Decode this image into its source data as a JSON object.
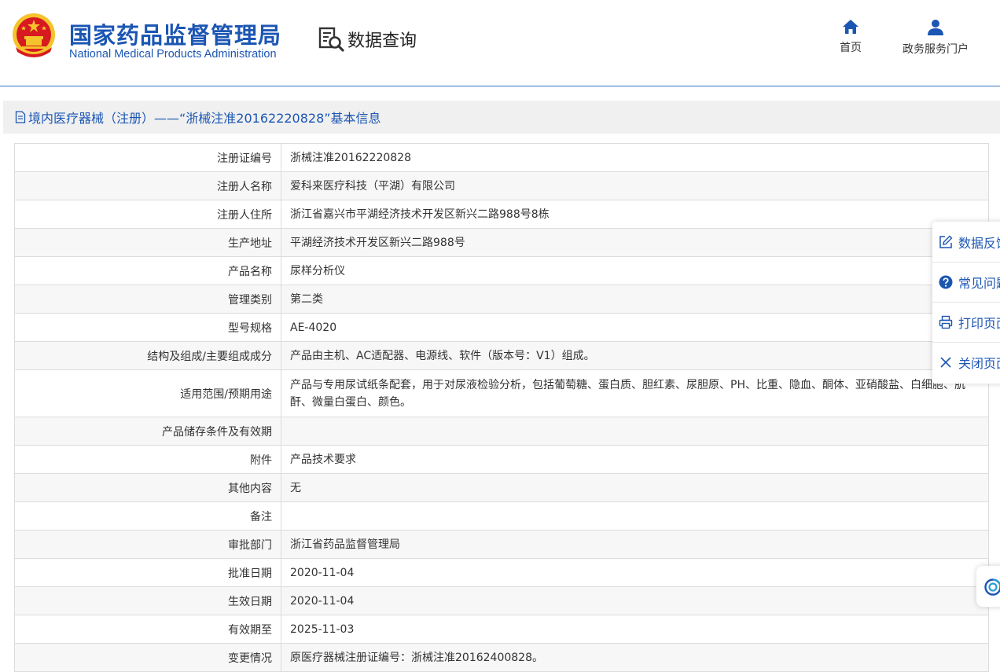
{
  "header": {
    "logo_cn": "国家药品监督管理局",
    "logo_en": "National Medical Products Administration",
    "query_label": "数据查询",
    "nav": [
      {
        "label": "首页",
        "icon": "home-icon"
      },
      {
        "label": "政务服务门户",
        "icon": "user-icon"
      }
    ]
  },
  "section": {
    "title": "境内医疗器械（注册）——“浙械注准20162220828”基本信息"
  },
  "table": {
    "rows": [
      {
        "key": "注册证编号",
        "value": "浙械注准20162220828"
      },
      {
        "key": "注册人名称",
        "value": "爱科来医疗科技（平湖）有限公司"
      },
      {
        "key": "注册人住所",
        "value": "浙江省嘉兴市平湖经济技术开发区新兴二路988号8栋"
      },
      {
        "key": "生产地址",
        "value": "平湖经济技术开发区新兴二路988号"
      },
      {
        "key": "产品名称",
        "value": "尿样分析仪"
      },
      {
        "key": "管理类别",
        "value": "第二类"
      },
      {
        "key": "型号规格",
        "value": "AE-4020"
      },
      {
        "key": "结构及组成/主要组成成分",
        "value": "产品由主机、AC适配器、电源线、软件（版本号：V1）组成。"
      },
      {
        "key": "适用范围/预期用途",
        "value": "产品与专用尿试纸条配套，用于对尿液检验分析，包括葡萄糖、蛋白质、胆红素、尿胆原、PH、比重、隐血、酮体、亚硝酸盐、白细胞、肌酐、微量白蛋白、颜色。"
      },
      {
        "key": "产品储存条件及有效期",
        "value": ""
      },
      {
        "key": "附件",
        "value": "产品技术要求"
      },
      {
        "key": "其他内容",
        "value": "无"
      },
      {
        "key": "备注",
        "value": ""
      },
      {
        "key": "审批部门",
        "value": "浙江省药品监督管理局"
      },
      {
        "key": "批准日期",
        "value": "2020-11-04"
      },
      {
        "key": "生效日期",
        "value": "2020-11-04"
      },
      {
        "key": "有效期至",
        "value": "2025-11-03"
      },
      {
        "key": "变更情况",
        "value": "原医疗器械注册证编号：浙械注准20162400828。"
      }
    ]
  },
  "side_panel": {
    "items": [
      {
        "label": "数据反馈",
        "icon": "edit-icon"
      },
      {
        "label": "常见问题",
        "icon": "question-icon"
      },
      {
        "label": "打印页面",
        "icon": "print-icon"
      },
      {
        "label": "关闭页面",
        "icon": "close-icon"
      }
    ]
  },
  "colors": {
    "brand_blue": "#1c56b3",
    "emblem_red": "#d71920",
    "emblem_gold": "#f5c32b",
    "row_alt": "#f7f7f7",
    "border": "#dcdcdc"
  }
}
